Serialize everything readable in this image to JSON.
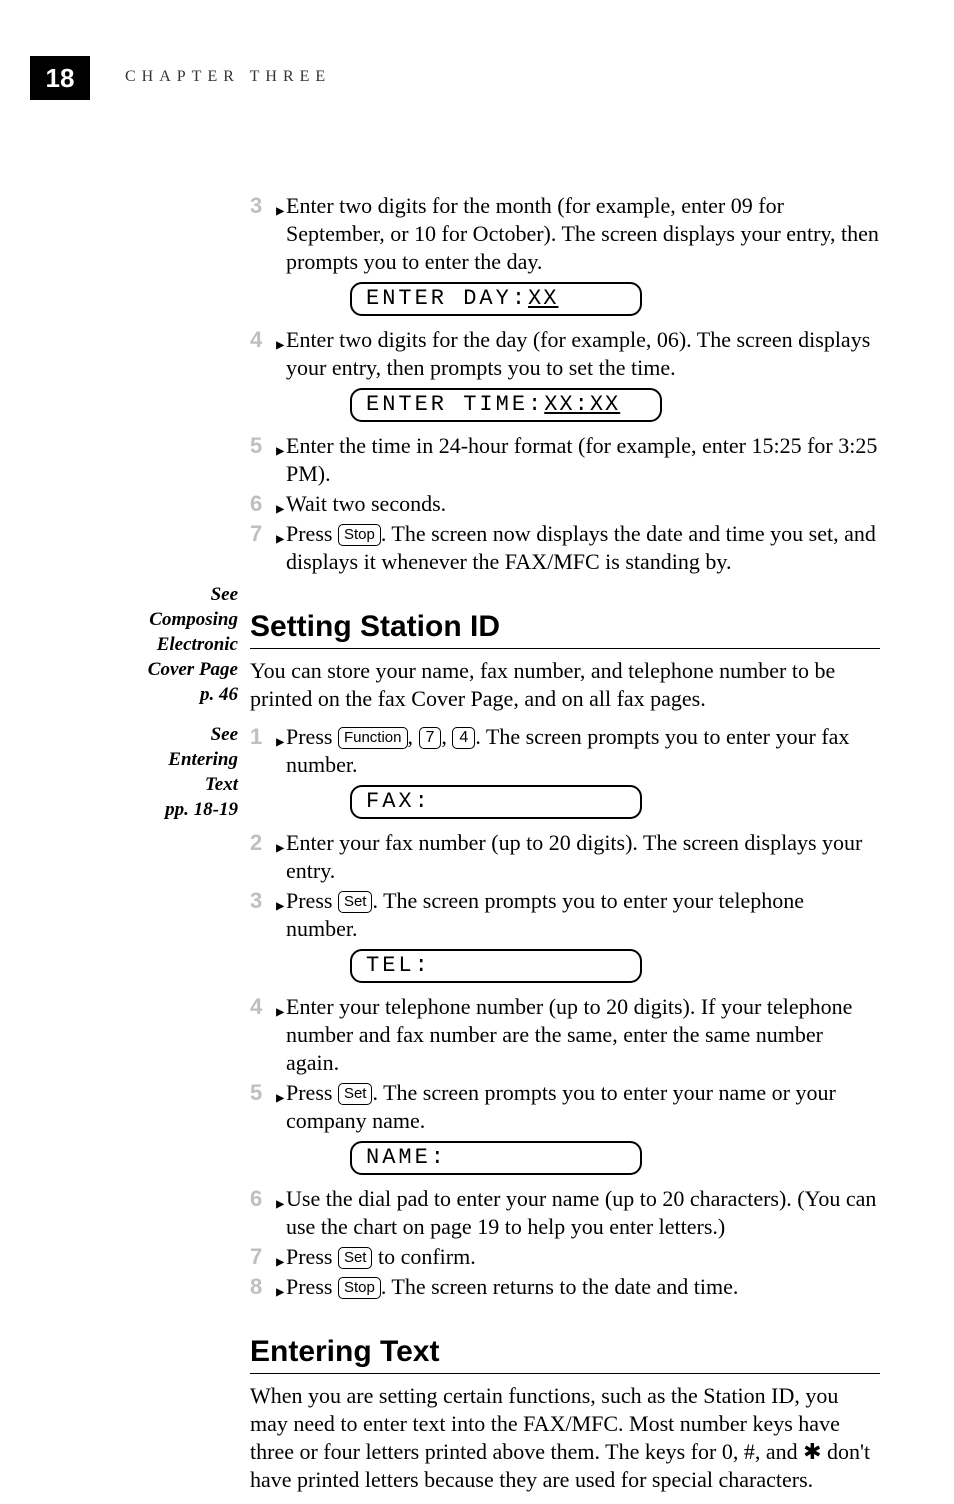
{
  "header": {
    "page_number": "18",
    "chapter": "CHAPTER THREE"
  },
  "margin_notes": {
    "note1_l1": "See",
    "note1_l2": "Composing",
    "note1_l3": "Electronic",
    "note1_l4": "Cover Page",
    "note1_l5": "p. 46",
    "note2_l1": "See",
    "note2_l2": "Entering",
    "note2_l3": "Text",
    "note2_l4": "pp. 18-19"
  },
  "keys": {
    "function": "Function",
    "seven": "7",
    "four": "4",
    "set": "Set",
    "stop": "Stop"
  },
  "lcd": {
    "enter_day": "ENTER DAY:",
    "enter_day_x": "XX",
    "enter_time": "ENTER TIME:",
    "enter_time_x": "XX:XX",
    "fax": "FAX:",
    "tel": "TEL:",
    "name": "NAME:"
  },
  "date_steps": {
    "s3_num": "3",
    "s3_text": "Enter two digits for the month (for example, enter 09 for September, or 10 for October). The screen displays your entry, then prompts you to enter the day.",
    "s4_num": "4",
    "s4_text": "Enter two digits for the day (for example, 06). The screen displays your entry, then prompts you to set the time.",
    "s5_num": "5",
    "s5_text": "Enter the time in 24-hour format (for example, enter 15:25 for 3:25 PM).",
    "s6_num": "6",
    "s6_text": "Wait two seconds.",
    "s7_num": "7",
    "s7_pre": "Press ",
    "s7_post": ". The screen now displays the date and time you set, and displays it whenever the FAX/MFC is standing by."
  },
  "station": {
    "heading": "Setting Station ID",
    "intro": "You can store your name, fax number, and telephone number to be printed on the fax Cover Page, and on all fax pages.",
    "s1_num": "1",
    "s1_pre": "Press ",
    "s1_mid1": ", ",
    "s1_mid2": ", ",
    "s1_post": ". The screen prompts you to enter your fax number.",
    "s2_num": "2",
    "s2_text": "Enter your fax number (up to 20 digits). The screen displays your entry.",
    "s3_num": "3",
    "s3_pre": "Press ",
    "s3_post": ". The screen prompts you to enter your telephone number.",
    "s4_num": "4",
    "s4_text": "Enter your telephone number (up to 20 digits). If your telephone number and fax number are the same, enter the same number again.",
    "s5_num": "5",
    "s5_pre": "Press ",
    "s5_post": ". The screen prompts you to enter your name or your company name.",
    "s6_num": "6",
    "s6_text": "Use the dial pad to enter your name (up to 20 characters). (You can use the chart on page 19 to help you enter letters.)",
    "s7_num": "7",
    "s7_pre": "Press ",
    "s7_post": " to confirm.",
    "s8_num": "8",
    "s8_pre": "Press ",
    "s8_post": ". The screen returns to the date and time."
  },
  "entering_text": {
    "heading": "Entering Text",
    "para": "When you are setting certain functions, such as the Station ID, you may need to enter text into the FAX/MFC. Most number keys have three or four letters printed above them. The keys for 0, #, and ✱ don't have printed letters because they are used for special characters."
  }
}
